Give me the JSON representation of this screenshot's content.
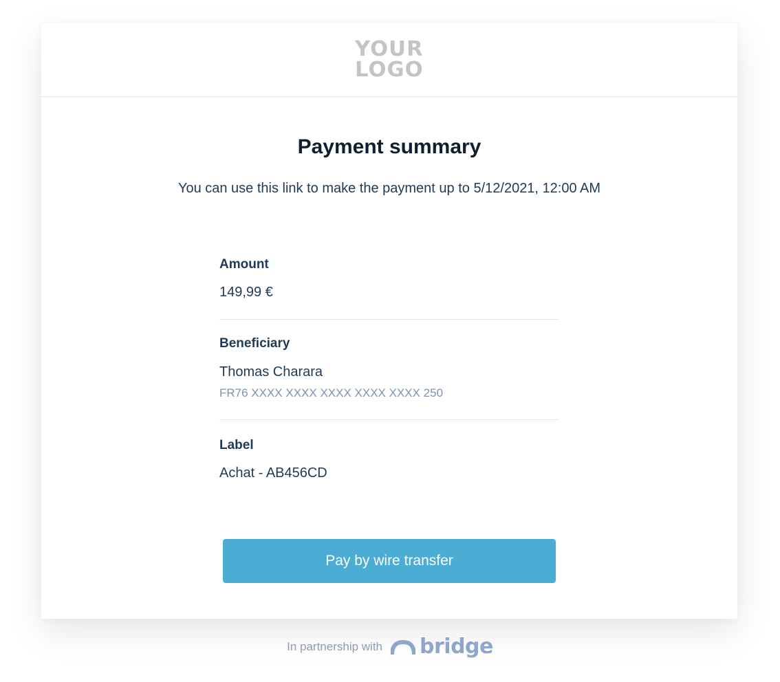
{
  "header": {
    "logo_line_1": "YOUR",
    "logo_line_2": "LOGO"
  },
  "summary": {
    "title": "Payment summary",
    "subtitle": "You can use this link to make the payment up to 5/12/2021, 12:00 AM"
  },
  "details": {
    "amount": {
      "label": "Amount",
      "value": "149,99 €"
    },
    "beneficiary": {
      "label": "Beneficiary",
      "name": "Thomas Charara",
      "iban": "FR76 XXXX XXXX XXXX XXXX XXXX 250"
    },
    "label": {
      "label": "Label",
      "value": "Achat - AB456CD"
    }
  },
  "actions": {
    "pay_label": "Pay by wire transfer"
  },
  "footer": {
    "partnership_text": "In partnership with",
    "brand": "bridge"
  },
  "colors": {
    "button": "#4badd4",
    "heading": "#0f1f2e",
    "text": "#1f3a56",
    "muted": "#7f93b0",
    "brand": "#8ea5cc"
  }
}
